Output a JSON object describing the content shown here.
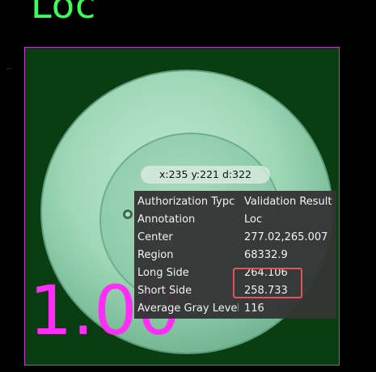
{
  "title_text": "Loc",
  "score_text": "1.00",
  "cursor_readout": "x:235 y:221 d:322",
  "info_header": {
    "key": "Authorization Typc",
    "value": "Validation Result"
  },
  "info_rows": [
    {
      "key": "Annotation",
      "value": "Loc"
    },
    {
      "key": "Center",
      "value": "277.02,265.007"
    },
    {
      "key": "Region",
      "value": "68332.9"
    },
    {
      "key": "Long Side",
      "value": "264.106"
    },
    {
      "key": "Short Side",
      "value": "258.733"
    },
    {
      "key": "Average Gray Level",
      "value": "116"
    }
  ],
  "colors": {
    "title": "#3bff5a",
    "score": "#ff2df5",
    "roi_border": "#c23cc6",
    "highlight": "#e0545e"
  },
  "icons": {
    "corner_mark": "crosshair-icon"
  }
}
